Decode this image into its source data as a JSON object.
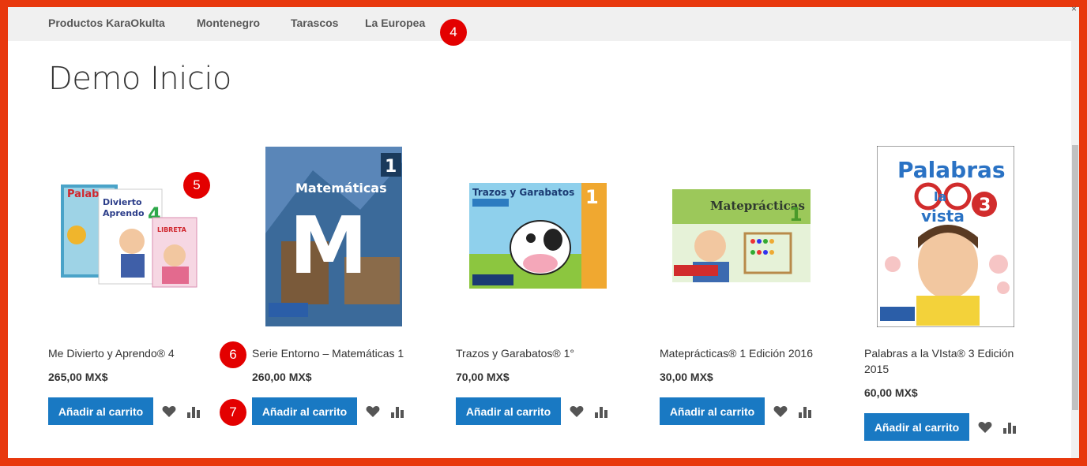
{
  "nav": {
    "items": [
      {
        "label": "Productos KaraOkulta"
      },
      {
        "label": "Montenegro"
      },
      {
        "label": "Tarascos"
      },
      {
        "label": "La Europea"
      }
    ]
  },
  "close_glyph": "×",
  "page": {
    "title": "Demo Inicio"
  },
  "badges": [
    "4",
    "5",
    "6",
    "7"
  ],
  "colors": {
    "accent": "#1979c3",
    "frame": "#e8380d",
    "badge": "#e30000",
    "navbar": "#f0f0f0"
  },
  "products": [
    {
      "name": "Me Divierto y Aprendo® 4",
      "price": "265,00 MX$",
      "cart_label": "Añadir al carrito",
      "image_text": "Me Divierto y Aprendo 4"
    },
    {
      "name": "Serie Entorno – Matemáticas 1",
      "price": "260,00 MX$",
      "cart_label": "Añadir al carrito",
      "image_text": "Matemáticas"
    },
    {
      "name": "Trazos y Garabatos® 1°",
      "price": "70,00 MX$",
      "cart_label": "Añadir al carrito",
      "image_text": "Trazos y Garabatos"
    },
    {
      "name": "Mateprácticas® 1 Edición 2016",
      "price": "30,00 MX$",
      "cart_label": "Añadir al carrito",
      "image_text": "Mateprácticas"
    },
    {
      "name": "Palabras a la VIsta® 3 Edición 2015",
      "price": "60,00 MX$",
      "cart_label": "Añadir al carrito",
      "image_text": "Palabras a la vista 3"
    }
  ],
  "icons": {
    "wishlist": "heart-icon",
    "compare": "compare-icon"
  }
}
